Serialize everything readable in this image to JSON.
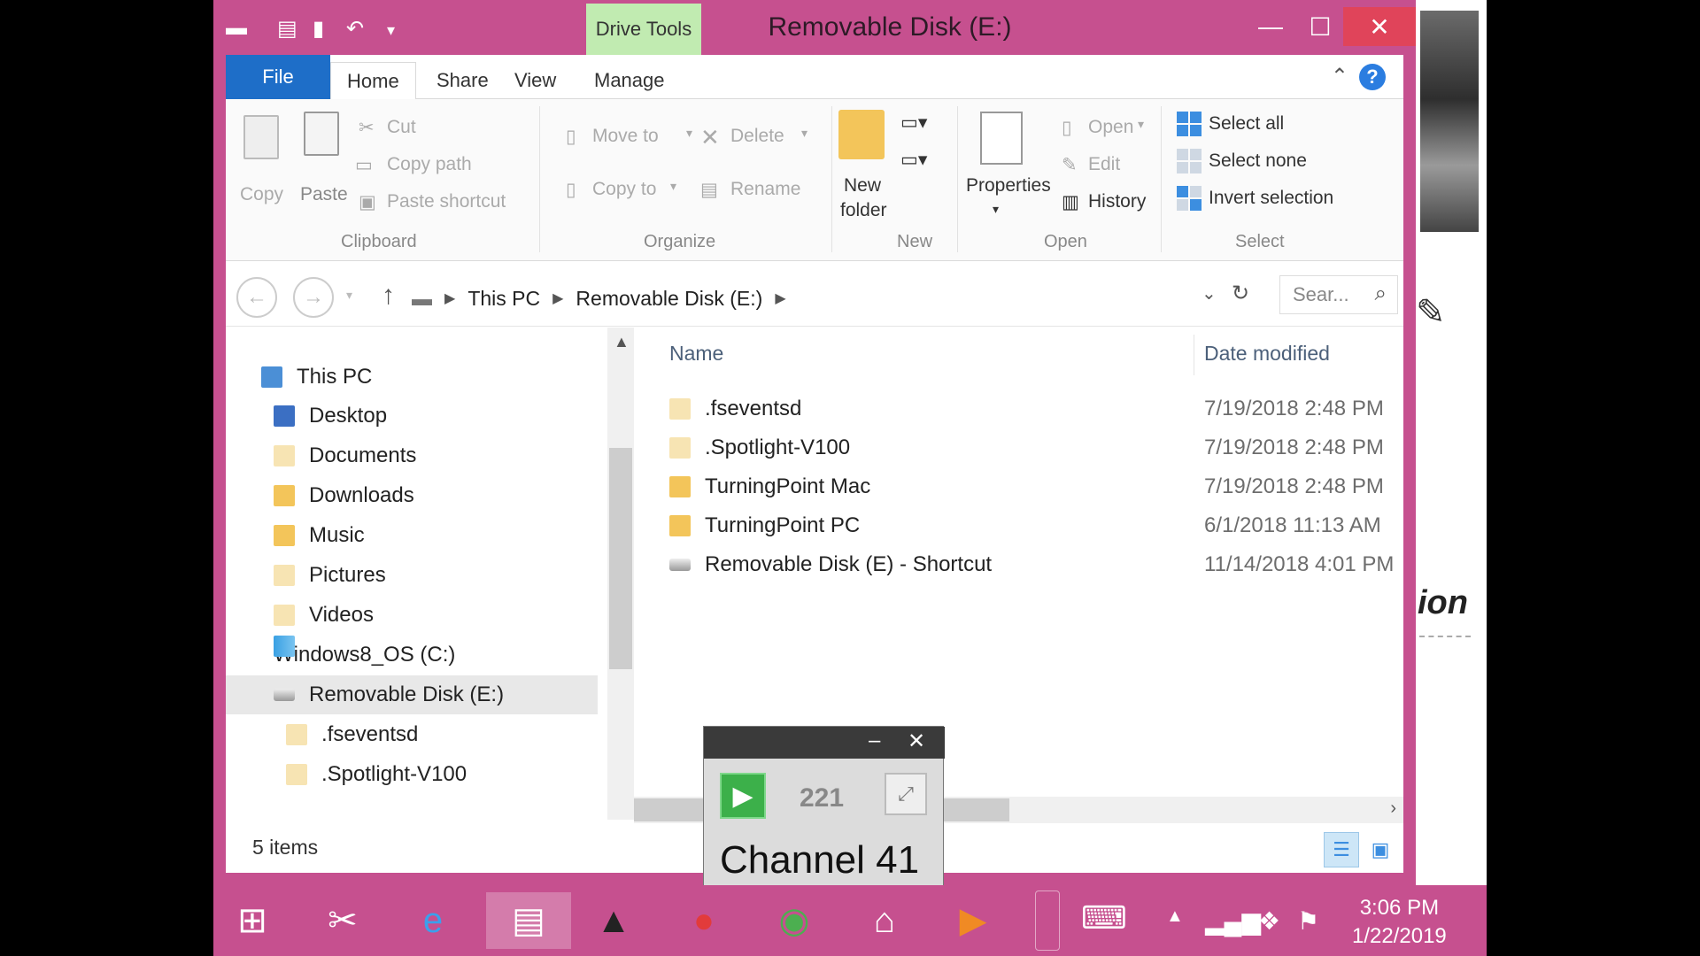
{
  "window": {
    "title": "Removable Disk (E:)",
    "context_tab": "Drive Tools",
    "accent": "#c6508f"
  },
  "ribbon": {
    "tabs": [
      "File",
      "Home",
      "Share",
      "View",
      "Manage"
    ],
    "clipboard": {
      "copy": "Copy",
      "paste": "Paste",
      "cut": "Cut",
      "copy_path": "Copy path",
      "paste_shortcut": "Paste shortcut",
      "label": "Clipboard"
    },
    "organize": {
      "move_to": "Move to",
      "copy_to": "Copy to",
      "delete": "Delete",
      "rename": "Rename",
      "label": "Organize"
    },
    "new": {
      "new_folder_line1": "New",
      "new_folder_line2": "folder",
      "label": "New"
    },
    "open": {
      "properties": "Properties",
      "open": "Open",
      "edit": "Edit",
      "history": "History",
      "label": "Open"
    },
    "select": {
      "select_all": "Select all",
      "select_none": "Select none",
      "invert": "Invert selection",
      "label": "Select"
    }
  },
  "address": {
    "crumbs": [
      "This PC",
      "Removable Disk (E:)"
    ],
    "search_placeholder": "Sear..."
  },
  "nav_pane": {
    "items": [
      {
        "label": "This PC",
        "icon": "computer-icon"
      },
      {
        "label": "Desktop",
        "icon": "desktop-folder-icon"
      },
      {
        "label": "Documents",
        "icon": "documents-folder-icon"
      },
      {
        "label": "Downloads",
        "icon": "downloads-folder-icon"
      },
      {
        "label": "Music",
        "icon": "music-folder-icon"
      },
      {
        "label": "Pictures",
        "icon": "pictures-folder-icon"
      },
      {
        "label": "Videos",
        "icon": "videos-folder-icon"
      },
      {
        "label": "Windows8_OS (C:)",
        "icon": "drive-icon"
      },
      {
        "label": "Removable Disk (E:)",
        "icon": "usb-drive-icon"
      },
      {
        "label": ".fseventsd",
        "icon": "folder-icon"
      },
      {
        "label": ".Spotlight-V100",
        "icon": "folder-icon"
      }
    ]
  },
  "file_list": {
    "columns": [
      "Name",
      "Date modified"
    ],
    "rows": [
      {
        "name": ".fseventsd",
        "date": "7/19/2018 2:48 PM",
        "icon": "folder-icon"
      },
      {
        "name": ".Spotlight-V100",
        "date": "7/19/2018 2:48 PM",
        "icon": "folder-icon"
      },
      {
        "name": "TurningPoint Mac",
        "date": "7/19/2018 2:48 PM",
        "icon": "folder-icon"
      },
      {
        "name": "TurningPoint PC",
        "date": "6/1/2018 11:13 AM",
        "icon": "folder-icon"
      },
      {
        "name": "Removable Disk (E) - Shortcut",
        "date": "11/14/2018 4:01 PM",
        "icon": "shortcut-icon"
      }
    ]
  },
  "status": {
    "count": "5 items"
  },
  "mini_window": {
    "number": "221",
    "channel": "Channel 41"
  },
  "taskbar": {
    "time": "3:06 PM",
    "date": "1/22/2019"
  },
  "background": {
    "partial_text": "ion"
  }
}
